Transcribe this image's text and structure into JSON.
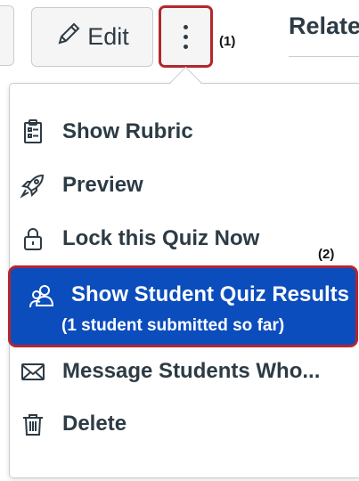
{
  "toolbar": {
    "edit_label": "Edit",
    "related_heading": "Relate"
  },
  "callouts": {
    "one": "(1)",
    "two": "(2)"
  },
  "menu": {
    "items": [
      {
        "label": "Show Rubric",
        "icon": "rubric-icon"
      },
      {
        "label": "Preview",
        "icon": "rocket-icon"
      },
      {
        "label": "Lock this Quiz Now",
        "icon": "lock-icon"
      },
      {
        "label": "Show Student Quiz Results",
        "sublabel": "(1 student submitted so far)",
        "icon": "users-icon",
        "highlighted": true
      },
      {
        "label": "Message Students Who...",
        "icon": "envelope-icon"
      },
      {
        "label": "Delete",
        "icon": "trash-icon"
      }
    ]
  },
  "colors": {
    "highlight_bg": "#0b4dbd",
    "callout_border": "#b3272d",
    "text": "#2d3b45"
  }
}
